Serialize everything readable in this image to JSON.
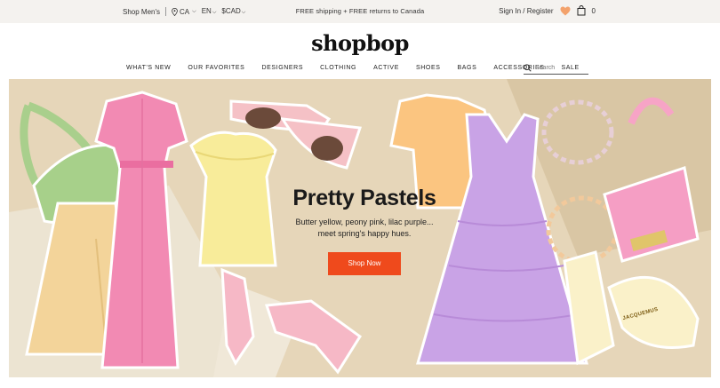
{
  "utility": {
    "shop_mens": "Shop Men's",
    "country": "CA",
    "language": "EN",
    "currency": "$CAD",
    "promo": "FREE shipping + FREE returns to Canada",
    "sign_in": "Sign In / Register",
    "cart_count": "0"
  },
  "logo": "shopbop",
  "nav": {
    "items": [
      "WHAT'S NEW",
      "OUR FAVORITES",
      "DESIGNERS",
      "CLOTHING",
      "ACTIVE",
      "SHOES",
      "BAGS",
      "ACCESSORIES",
      "SALE"
    ],
    "search_placeholder": "Search"
  },
  "hero": {
    "title": "Pretty Pastels",
    "subtitle_line1": "Butter yellow, peony pink, lilac purple...",
    "subtitle_line2": "meet spring's happy hues.",
    "cta": "Shop Now",
    "bag_logo_text": "JACQUEMUS"
  },
  "colors": {
    "accent": "#ef4a1c",
    "heart": "#f3a26c",
    "hero_bg": "#e3d3b6"
  }
}
